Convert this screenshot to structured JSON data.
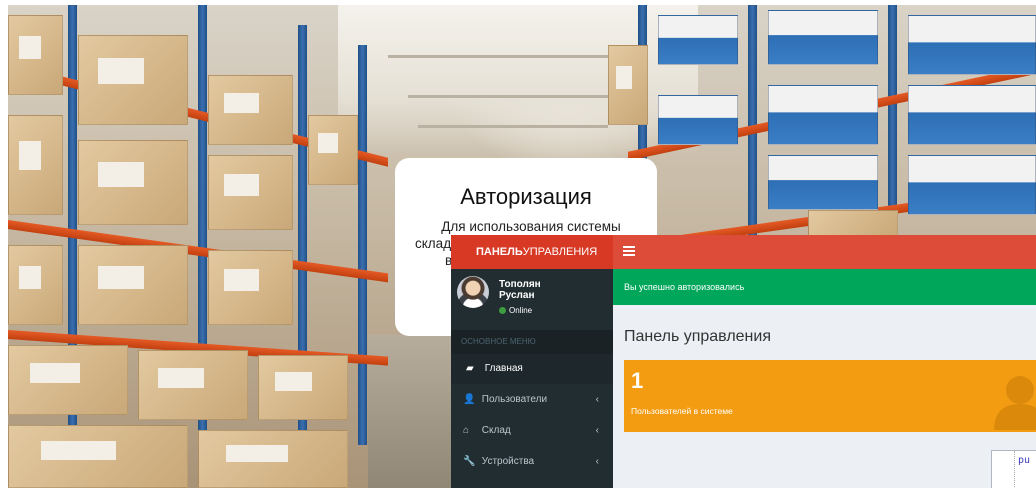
{
  "login": {
    "title": "Авторизация",
    "text_line1": "Для использования системы",
    "text_line2": "склад",
    "text_line3": "в"
  },
  "panel": {
    "logo_bold": "ПАНЕЛЬ",
    "logo_rest": "УПРАВЛЕНИЯ",
    "user": {
      "first_line": "Тополян",
      "second_line": "Руслан",
      "status": "Online"
    },
    "menu_header": "ОСНОВНОЕ МЕНЮ",
    "menu_items": [
      {
        "label": "Главная",
        "icon": "book-icon",
        "glyph": "▰",
        "active": true
      },
      {
        "label": "Пользователи",
        "icon": "user-icon",
        "glyph": "👤",
        "chevron": "‹"
      },
      {
        "label": "Склад",
        "icon": "home-icon",
        "glyph": "⌂",
        "chevron": "‹"
      },
      {
        "label": "Устройства",
        "icon": "wrench-icon",
        "glyph": "🔧",
        "chevron": "‹"
      }
    ],
    "alert": "Вы успешно авторизовались",
    "content_title": "Панель управления",
    "info_box": {
      "number": "1",
      "label": "Пользователей в системе",
      "icon": "user-silhouette-icon"
    },
    "code_snippet": "pu"
  },
  "colors": {
    "logo_bg": "#d73925",
    "topbar_bg": "#dd4b39",
    "sidebar_bg": "#222d32",
    "alert_bg": "#00a65a",
    "info_box_bg": "#f39c12"
  }
}
